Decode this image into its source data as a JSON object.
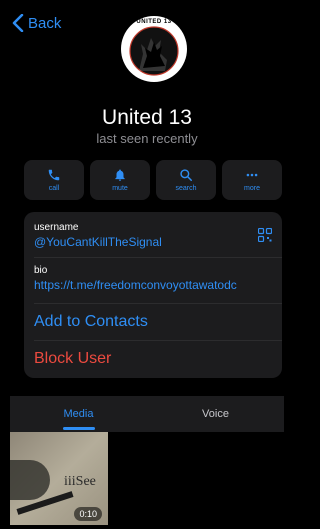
{
  "nav": {
    "back_label": "Back"
  },
  "profile": {
    "avatar_text": "UNITED 13",
    "name": "United 13",
    "status": "last seen recently"
  },
  "actions": [
    {
      "label": "call",
      "icon": "phone-icon"
    },
    {
      "label": "mute",
      "icon": "bell-icon"
    },
    {
      "label": "search",
      "icon": "search-icon"
    },
    {
      "label": "more",
      "icon": "more-icon"
    }
  ],
  "info": {
    "username_label": "username",
    "username": "@YouCantKillTheSignal",
    "bio_label": "bio",
    "bio": "https://t.me/freedomconvoyottawatodc",
    "add_contacts": "Add to Contacts",
    "block": "Block User"
  },
  "tabs": [
    {
      "label": "Media",
      "active": true
    },
    {
      "label": "Voice",
      "active": false
    }
  ],
  "media": [
    {
      "duration": "0:10",
      "overlay_text": "iiiSee"
    }
  ],
  "colors": {
    "accent": "#2f8ef4",
    "danger": "#eb4a3f",
    "surface": "#1c1c1e"
  }
}
